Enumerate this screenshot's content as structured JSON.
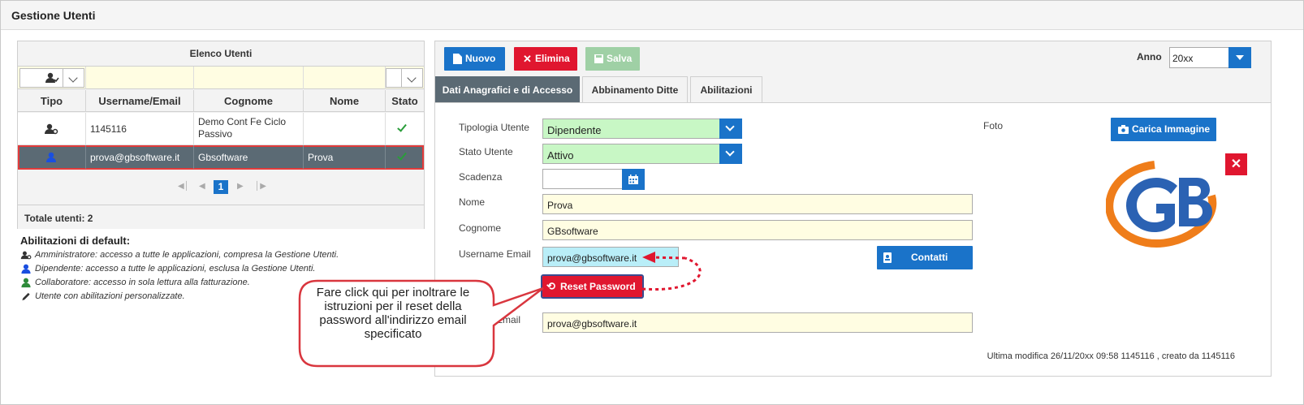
{
  "window": {
    "title": "Gestione Utenti"
  },
  "left_panel": {
    "title": "Elenco Utenti",
    "columns": [
      "Tipo",
      "Username/Email",
      "Cognome",
      "Nome",
      "Stato"
    ],
    "rows": [
      {
        "tipo_icon": "admin-user-icon",
        "username": "1145116",
        "cognome": "Demo Cont Fe Ciclo Passivo",
        "nome": "",
        "stato_icon": "check-icon"
      },
      {
        "tipo_icon": "dependent-user-icon",
        "username": "prova@gbsoftware.it",
        "cognome": "Gbsoftware",
        "nome": "Prova",
        "stato_icon": "check-icon"
      }
    ],
    "pager": {
      "current_page": "1"
    },
    "totale": "Totale utenti: 2"
  },
  "legend": {
    "title": "Abilitazioni di default:",
    "items": [
      {
        "icon": "admin-user-icon",
        "text": "Amministratore: accesso a tutte le applicazioni, compresa la Gestione Utenti."
      },
      {
        "icon": "dependent-user-icon",
        "text": "Dipendente: accesso a tutte le applicazioni, esclusa la Gestione Utenti."
      },
      {
        "icon": "collaborator-user-icon",
        "text": "Collaboratore: accesso in sola lettura alla fatturazione."
      },
      {
        "icon": "pencil-icon",
        "text": "Utente con abilitazioni personalizzate."
      }
    ]
  },
  "toolbar": {
    "nuovo": "Nuovo",
    "elimina": "Elimina",
    "salva": "Salva",
    "anno_label": "Anno",
    "anno_value": "20xx"
  },
  "tabs": [
    "Dati Anagrafici e di Accesso",
    "Abbinamento Ditte",
    "Abilitazioni"
  ],
  "form": {
    "tipologia_label": "Tipologia Utente",
    "tipologia_value": "Dipendente",
    "stato_label": "Stato Utente",
    "stato_value": "Attivo",
    "scadenza_label": "Scadenza",
    "scadenza_value": "",
    "nome_label": "Nome",
    "nome_value": "Prova",
    "cognome_label": "Cognome",
    "cognome_value": "GBsoftware",
    "username_label": "Username Email",
    "username_value": "prova@gbsoftware.it",
    "email_label": "Email",
    "email_value": "prova@gbsoftware.it",
    "foto_label": "Foto",
    "carica_label": "Carica Immagine",
    "contatti_label": "Contatti",
    "reset_label": "Reset Password",
    "ultima_modifica": "Ultima modifica 26/11/20xx 09:58 1145116 , creato da 1145116"
  },
  "callout": {
    "text": "Fare click qui per inoltrare le istruzioni per il reset della password all'indirizzo email specificato"
  },
  "colors": {
    "primary_blue": "#1a73c9",
    "danger_red": "#e0162f",
    "success_green": "#9fd0a5",
    "selected_row": "#5b6a74",
    "input_yellow": "#fffde2",
    "select_green": "#c8f7c5"
  }
}
